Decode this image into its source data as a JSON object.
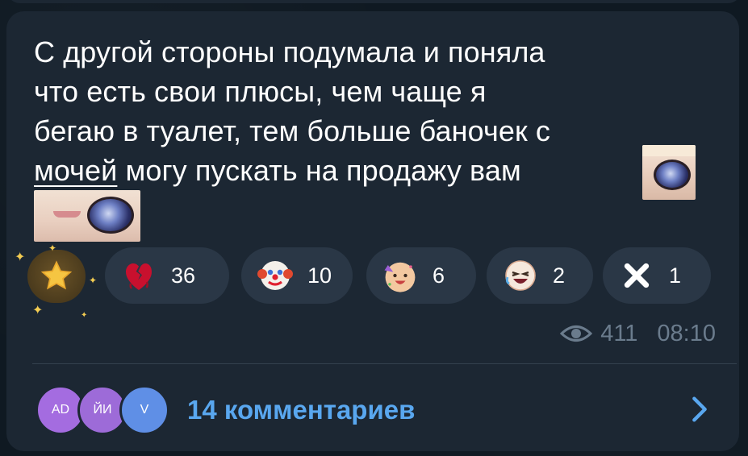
{
  "message": {
    "lines": [
      "С другой стороны подумала и поняла",
      "что есть свои плюсы, чем чаще я",
      "бегаю в туалет, тем больше баночек с",
      "мочей",
      "могу пускать на продажу вам"
    ]
  },
  "reactions": [
    {
      "icon": "broken-heart-icon",
      "count": "36"
    },
    {
      "icon": "clown-face-icon",
      "count": "10"
    },
    {
      "icon": "party-face-icon",
      "count": "6"
    },
    {
      "icon": "laughing-face-icon",
      "count": "2"
    },
    {
      "icon": "x-mark-icon",
      "count": "1"
    }
  ],
  "meta": {
    "views": "411",
    "time": "08:10",
    "views_icon": "eye-icon"
  },
  "comments": {
    "label": "14 комментариев",
    "avatars": [
      "AD",
      "ЙИ",
      "V"
    ],
    "accent": "#59a7ef"
  },
  "colors": {
    "background": "#0f1922",
    "bubble": "#1c2733",
    "reaction_pill": "#2a3746",
    "muted_text": "#6b7c8d"
  }
}
